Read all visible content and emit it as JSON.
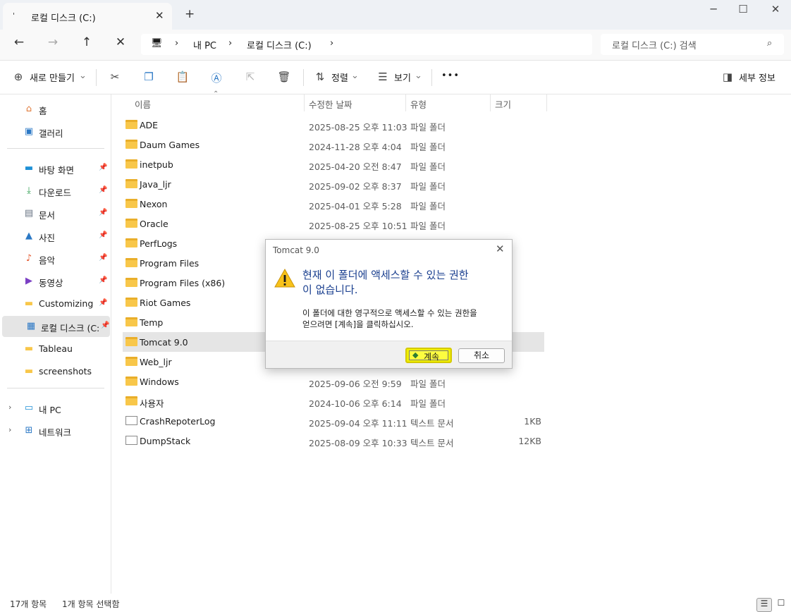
{
  "window": {
    "tab_label": "로컬 디스크 (C:)",
    "tab_icon": "'",
    "new_tab": "+",
    "close": "✕",
    "minimize": "─",
    "maximize": "☐"
  },
  "nav": {
    "back": "←",
    "forward": "→",
    "up": "↑",
    "stop": "✕",
    "pc_icon": "🖥",
    "sep": "›",
    "crumbs": [
      "내 PC",
      "로컬 디스크 (C:)"
    ],
    "search_placeholder": "로컬 디스크 (C:) 검색",
    "search_icon": "⌕"
  },
  "toolbar": {
    "new_icon": "⊕",
    "new_label": "새로 만들기",
    "caret": "⌄",
    "cut_icon": "✂",
    "copy_icon": "❐",
    "paste_icon": "📋",
    "rename_icon": "Ⓐ",
    "share_icon": "⇱",
    "delete_icon": "🗑",
    "sort_icon": "⇅",
    "sort_label": "정렬",
    "view_icon": "☰",
    "view_label": "보기",
    "more_label": "•••",
    "details_icon": "◨",
    "details_label": "세부 정보"
  },
  "sidebar": {
    "top": [
      {
        "label": "홈",
        "icon": "home-icon",
        "glyph": "⌂",
        "color": "#e07a3a"
      },
      {
        "label": "갤러리",
        "icon": "gallery-icon",
        "glyph": "▣",
        "color": "#2b78c5"
      }
    ],
    "pinned": [
      {
        "label": "바탕 화면",
        "icon": "desktop-icon",
        "glyph": "▬",
        "color": "#1e90d6"
      },
      {
        "label": "다운로드",
        "icon": "download-icon",
        "glyph": "⤓",
        "color": "#2e9e50"
      },
      {
        "label": "문서",
        "icon": "documents-icon",
        "glyph": "▤",
        "color": "#6a7685"
      },
      {
        "label": "사진",
        "icon": "pictures-icon",
        "glyph": "▲",
        "color": "#2b78c5"
      },
      {
        "label": "음악",
        "icon": "music-icon",
        "glyph": "♪",
        "color": "#e4572e"
      },
      {
        "label": "동영상",
        "icon": "videos-icon",
        "glyph": "▶",
        "color": "#7b3fc4"
      },
      {
        "label": "Customizing",
        "icon": "folder-icon",
        "glyph": "▬",
        "color": "#f8c74a"
      },
      {
        "label": "로컬 디스크 (C:)",
        "icon": "drive-icon",
        "glyph": "▦",
        "color": "#2b78c5"
      }
    ],
    "others": [
      {
        "label": "Tableau",
        "icon": "folder-icon",
        "glyph": "▬",
        "color": "#f8c74a"
      },
      {
        "label": "screenshots",
        "icon": "folder-icon",
        "glyph": "▬",
        "color": "#f8c74a"
      }
    ],
    "bottom": [
      {
        "label": "내 PC",
        "icon": "pc-icon",
        "glyph": "▭",
        "color": "#1e90d6"
      },
      {
        "label": "네트워크",
        "icon": "network-icon",
        "glyph": "⊞",
        "color": "#2b78c5"
      }
    ],
    "pin_glyph": "📌",
    "chev_glyph": "›"
  },
  "columns": {
    "name": "이름",
    "modified": "수정한 날짜",
    "type": "유형",
    "size": "크기",
    "sort_arrow": "⌃"
  },
  "files": [
    {
      "name": "ADE",
      "date": "2025-08-25 오후 11:03",
      "type": "파일 폴더",
      "size": "",
      "kind": "folder"
    },
    {
      "name": "Daum Games",
      "date": "2024-11-28 오후 4:04",
      "type": "파일 폴더",
      "size": "",
      "kind": "folder"
    },
    {
      "name": "inetpub",
      "date": "2025-04-20 오전 8:47",
      "type": "파일 폴더",
      "size": "",
      "kind": "folder"
    },
    {
      "name": "Java_ljr",
      "date": "2025-09-02 오후 8:37",
      "type": "파일 폴더",
      "size": "",
      "kind": "folder"
    },
    {
      "name": "Nexon",
      "date": "2025-04-01 오후 5:28",
      "type": "파일 폴더",
      "size": "",
      "kind": "folder"
    },
    {
      "name": "Oracle",
      "date": "2025-08-25 오후 10:51",
      "type": "파일 폴더",
      "size": "",
      "kind": "folder"
    },
    {
      "name": "PerfLogs",
      "date": "",
      "type": "",
      "size": "",
      "kind": "folder"
    },
    {
      "name": "Program Files",
      "date": "",
      "type": "",
      "size": "",
      "kind": "folder"
    },
    {
      "name": "Program Files (x86)",
      "date": "",
      "type": "",
      "size": "",
      "kind": "folder"
    },
    {
      "name": "Riot Games",
      "date": "",
      "type": "",
      "size": "",
      "kind": "folder"
    },
    {
      "name": "Temp",
      "date": "",
      "type": "",
      "size": "",
      "kind": "folder"
    },
    {
      "name": "Tomcat 9.0",
      "date": "",
      "type": "",
      "size": "",
      "kind": "folder"
    },
    {
      "name": "Web_ljr",
      "date": "",
      "type": "",
      "size": "",
      "kind": "folder"
    },
    {
      "name": "Windows",
      "date": "2025-09-06 오전 9:59",
      "type": "파일 폴더",
      "size": "",
      "kind": "folder"
    },
    {
      "name": "사용자",
      "date": "2024-10-06 오후 6:14",
      "type": "파일 폴더",
      "size": "",
      "kind": "folder"
    },
    {
      "name": "CrashRepoterLog",
      "date": "2025-09-04 오후 11:11",
      "type": "텍스트 문서",
      "size": "1KB",
      "kind": "doc"
    },
    {
      "name": "DumpStack",
      "date": "2025-08-09 오후 10:33",
      "type": "텍스트 문서",
      "size": "12KB",
      "kind": "doc"
    }
  ],
  "selected_index": 11,
  "status": {
    "count": "17개 항목",
    "selected": "1개 항목 선택함",
    "list_view": "☰",
    "tile_view": "☐"
  },
  "dialog": {
    "title": "Tomcat 9.0",
    "close": "✕",
    "main_line1": "현재 이 폴더에 액세스할 수 있는 권한",
    "main_line2": "이 없습니다.",
    "sub_line1": "이 폴더에 대한 영구적으로 액세스할 수 있는 권한을",
    "sub_line2": "얻으려면 [계속]을 클릭하십시오.",
    "continue_label": "계속",
    "shield_glyph": "◆",
    "cancel_label": "취소"
  }
}
